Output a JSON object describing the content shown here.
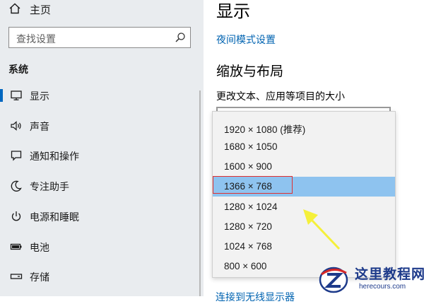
{
  "sidebar": {
    "home_label": "主页",
    "search_placeholder": "查找设置",
    "section_title": "系统",
    "items": [
      {
        "label": "显示",
        "icon": "monitor-icon",
        "selected": true
      },
      {
        "label": "声音",
        "icon": "speaker-icon",
        "selected": false
      },
      {
        "label": "通知和操作",
        "icon": "notification-icon",
        "selected": false
      },
      {
        "label": "专注助手",
        "icon": "moon-icon",
        "selected": false
      },
      {
        "label": "电源和睡眠",
        "icon": "power-icon",
        "selected": false
      },
      {
        "label": "电池",
        "icon": "battery-icon",
        "selected": false
      },
      {
        "label": "存储",
        "icon": "storage-icon",
        "selected": false
      }
    ]
  },
  "main": {
    "title": "显示",
    "night_mode_link": "夜间模式设置",
    "section_heading": "缩放与布局",
    "sub_label": "更改文本、应用等项目的大小",
    "partial_link": "连接到无线显示器"
  },
  "resolution_options": [
    {
      "label": "1920 × 1080 (推荐)",
      "selected": false
    },
    {
      "label": "1680 × 1050",
      "selected": false
    },
    {
      "label": "1600 × 900",
      "selected": false
    },
    {
      "label": "1366 × 768",
      "selected": true
    },
    {
      "label": "1280 × 1024",
      "selected": false
    },
    {
      "label": "1280 × 720",
      "selected": false
    },
    {
      "label": "1024 × 768",
      "selected": false
    },
    {
      "label": "800 × 600",
      "selected": false
    }
  ],
  "colors": {
    "sidebar_bg": "#e9ecef",
    "accent": "#0067c0",
    "selected_option_bg": "#8ec3ef",
    "annotation_box": "#e03030",
    "annotation_arrow": "#f5f03a"
  },
  "watermark": {
    "title": "这里教程网",
    "url": "herecours.com"
  }
}
